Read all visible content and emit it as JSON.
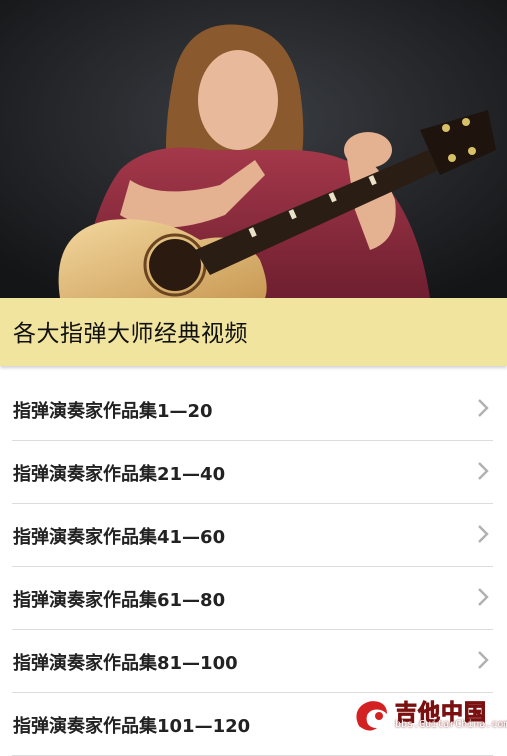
{
  "header": {
    "title": "各大指弹大师经典视频"
  },
  "list": {
    "items": [
      {
        "label": "指弹演奏家作品集1—20"
      },
      {
        "label": "指弹演奏家作品集21—40"
      },
      {
        "label": "指弹演奏家作品集41—60"
      },
      {
        "label": "指弹演奏家作品集61—80"
      },
      {
        "label": "指弹演奏家作品集81—100"
      },
      {
        "label": "指弹演奏家作品集101—120"
      }
    ]
  },
  "watermark": {
    "text": "吉他中国",
    "url": "bbs.GuitarChina.com"
  },
  "colors": {
    "header_bg": "#f1e49f",
    "divider": "#dcdcdc",
    "text": "#222222"
  },
  "icons": {
    "chevron": "chevron-right-icon",
    "logo": "guitarchina-logo-icon"
  }
}
